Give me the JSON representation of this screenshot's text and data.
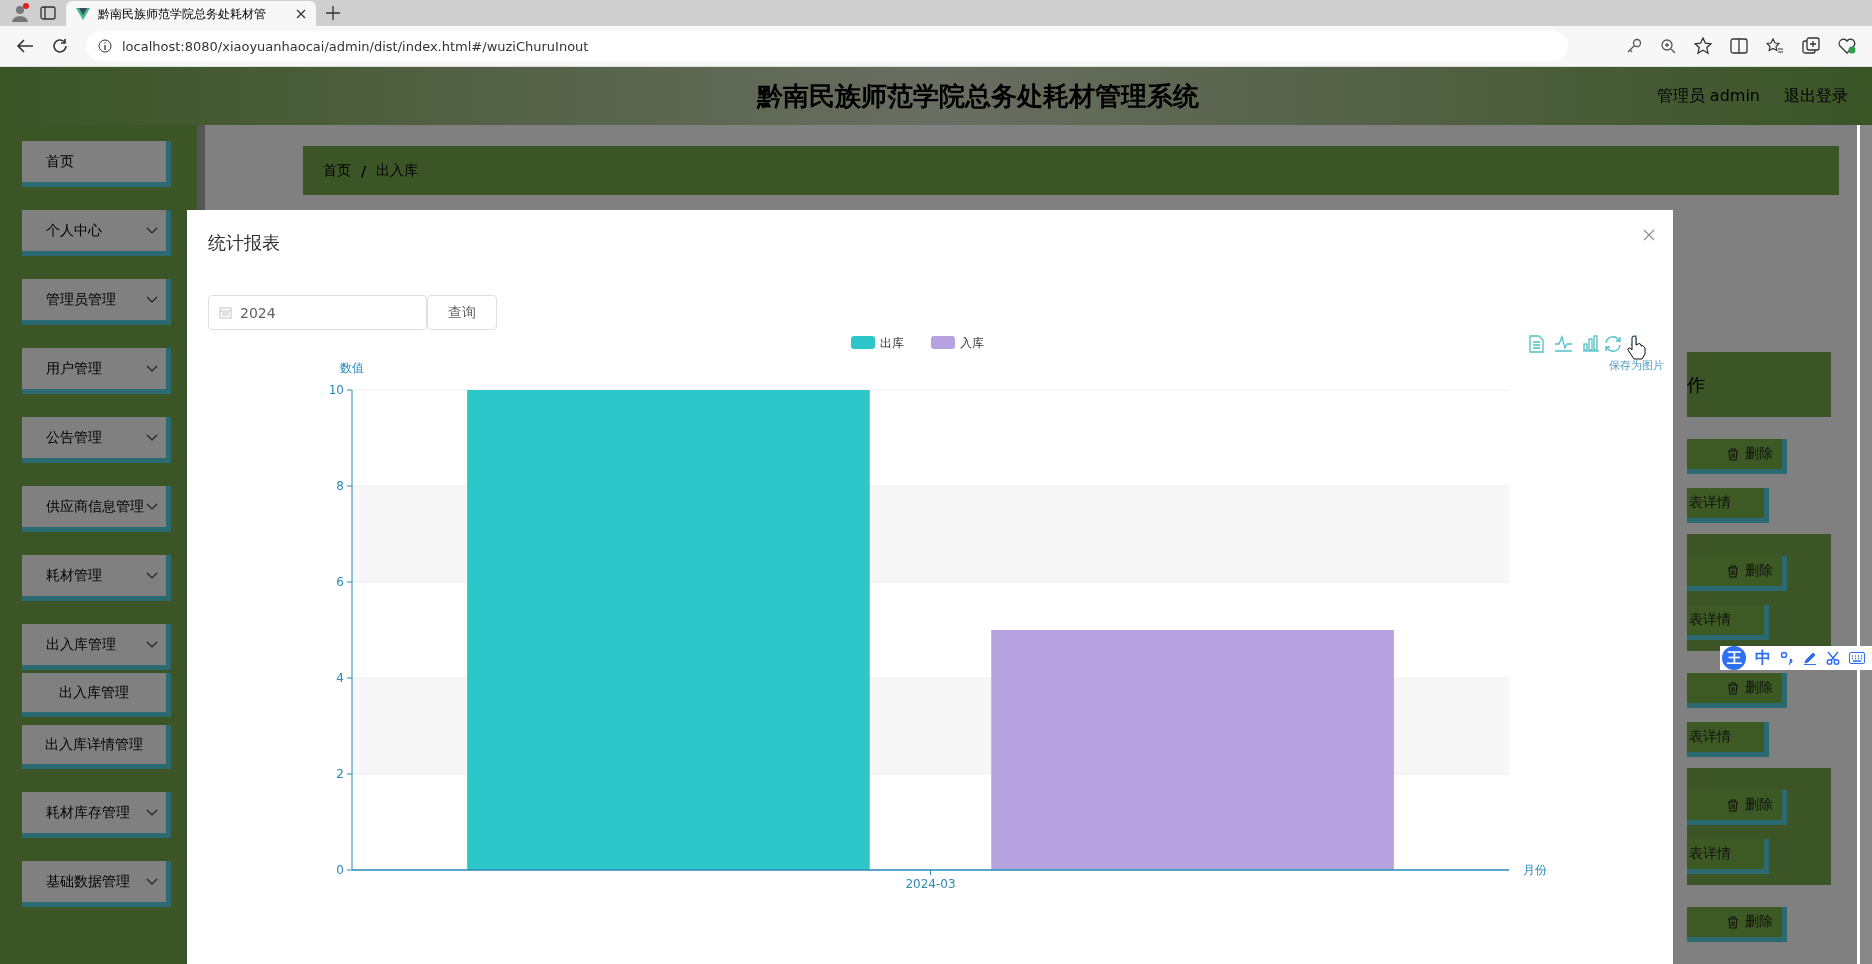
{
  "browser": {
    "tab_title": "黔南民族师范学院总务处耗材管",
    "url": "localhost:8080/xiaoyuanhaocai/admin/dist/index.html#/wuziChuruInout"
  },
  "header": {
    "title": "黔南民族师范学院总务处耗材管理系统",
    "user": "管理员 admin",
    "logout": "退出登录"
  },
  "sidebar": {
    "items": [
      {
        "label": "首页",
        "expandable": false
      },
      {
        "label": "个人中心",
        "expandable": true
      },
      {
        "label": "管理员管理",
        "expandable": true
      },
      {
        "label": "用户管理",
        "expandable": true
      },
      {
        "label": "公告管理",
        "expandable": true
      },
      {
        "label": "供应商信息管理",
        "expandable": true
      },
      {
        "label": "耗材管理",
        "expandable": true
      },
      {
        "label": "出入库管理",
        "expandable": true,
        "children": [
          {
            "label": "出入库管理"
          },
          {
            "label": "出入库详情管理"
          }
        ]
      },
      {
        "label": "耗材库存管理",
        "expandable": true
      },
      {
        "label": "基础数据管理",
        "expandable": true
      }
    ]
  },
  "breadcrumb": {
    "items": [
      "首页",
      "出入库"
    ],
    "separator": "/"
  },
  "table": {
    "header": "作",
    "rows": [
      {
        "delete": "删除",
        "details": "表详情"
      },
      {
        "delete": "删除",
        "details": "表详情"
      },
      {
        "delete": "删除",
        "details": "表详情"
      },
      {
        "delete": "删除",
        "details": "表详情"
      },
      {
        "delete": "删除"
      }
    ]
  },
  "modal": {
    "title": "统计报表",
    "date_value": "2024",
    "query_button": "查询",
    "toolbox_tooltip": "保存为图片",
    "chart_data": {
      "type": "bar",
      "xlabel": "月份",
      "ylabel": "数值",
      "categories": [
        "2024-03"
      ],
      "series": [
        {
          "name": "出库",
          "color": "#2ec7c9",
          "values": [
            10
          ]
        },
        {
          "name": "入库",
          "color": "#b6a2de",
          "values": [
            5
          ]
        }
      ],
      "ylim": [
        0,
        10
      ],
      "yticks": [
        0,
        2,
        4,
        6,
        8,
        10
      ],
      "grid": true,
      "legend": "top"
    }
  },
  "ime_bar": {
    "logo": "王",
    "mode": "中"
  }
}
